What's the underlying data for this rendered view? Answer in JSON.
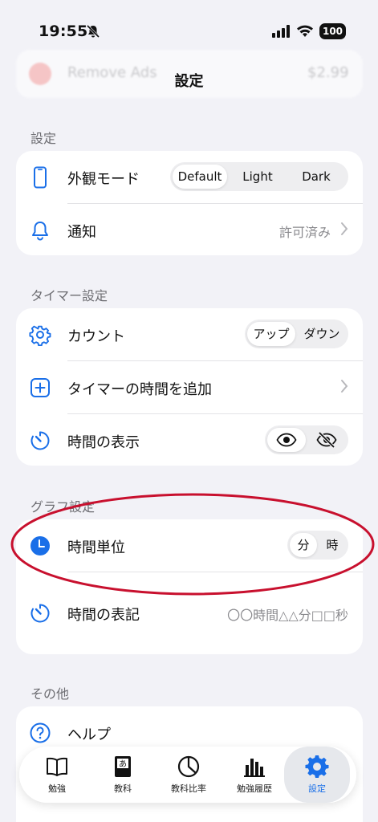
{
  "status_bar": {
    "time": "19:55",
    "battery": "100"
  },
  "ghost": {
    "item_label": "Remove Ads",
    "price": "$2.99"
  },
  "nav": {
    "title": "設定"
  },
  "sections": {
    "settings": {
      "label": "設定",
      "appearance": {
        "label": "外観モード",
        "options": [
          "Default",
          "Light",
          "Dark"
        ],
        "selected": "Default"
      },
      "notification": {
        "label": "通知",
        "value": "許可済み"
      }
    },
    "timer": {
      "label": "タイマー設定",
      "count": {
        "label": "カウント",
        "options": [
          "アップ",
          "ダウン"
        ],
        "selected": "アップ"
      },
      "add_time": {
        "label": "タイマーの時間を追加"
      },
      "display_time": {
        "label": "時間の表示"
      }
    },
    "graph": {
      "label": "グラフ設定",
      "time_unit": {
        "label": "時間単位",
        "options": [
          "分",
          "時"
        ],
        "selected": "分"
      },
      "time_format": {
        "label": "時間の表記",
        "value": "〇〇時間△△分□□秒"
      }
    },
    "other": {
      "label": "その他",
      "help": {
        "label": "ヘルプ"
      }
    }
  },
  "tabbar": {
    "tabs": [
      {
        "label": "勉強",
        "icon": "book-icon"
      },
      {
        "label": "教科",
        "icon": "textbook-icon"
      },
      {
        "label": "教科比率",
        "icon": "pie-chart-icon"
      },
      {
        "label": "勉強履歴",
        "icon": "bar-chart-icon"
      },
      {
        "label": "設定",
        "icon": "gear-icon"
      }
    ],
    "active": "設定"
  },
  "colors": {
    "accent": "#1a6fe8",
    "annotation": "#c8102e"
  }
}
